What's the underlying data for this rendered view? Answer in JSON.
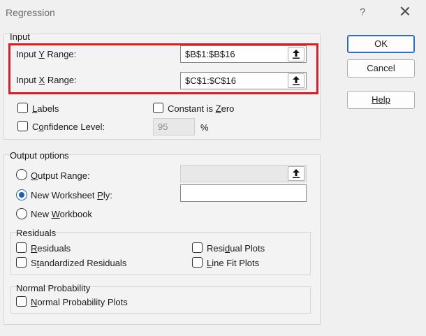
{
  "window": {
    "title": "Regression",
    "help_glyph": "?"
  },
  "buttons": {
    "ok": "OK",
    "cancel": "Cancel",
    "help": "Help"
  },
  "input_group": {
    "label": "Input",
    "y_range": {
      "label_pre": "Input ",
      "label_key": "Y",
      "label_post": " Range:",
      "value": "$B$1:$B$16"
    },
    "x_range": {
      "label_pre": "Input ",
      "label_key": "X",
      "label_post": " Range:",
      "value": "$C$1:$C$16"
    },
    "labels": {
      "key": "L",
      "rest": "abels",
      "checked": false
    },
    "constant_zero": {
      "pre": "Constant is ",
      "key": "Z",
      "rest": "ero",
      "checked": false
    },
    "confidence": {
      "pre": "C",
      "key": "o",
      "rest": "nfidence Level:",
      "value": "95",
      "unit": "%",
      "checked": false
    }
  },
  "output_group": {
    "label": "Output options",
    "output_range": {
      "key": "O",
      "rest": "utput Range:",
      "selected": false,
      "value": ""
    },
    "new_ply": {
      "pre": "New Worksheet ",
      "key": "P",
      "rest": "ly:",
      "selected": true,
      "value": ""
    },
    "new_workbook": {
      "pre": "New ",
      "key": "W",
      "rest": "orkbook",
      "selected": false
    }
  },
  "residuals_group": {
    "label": "Residuals",
    "residuals": {
      "key": "R",
      "rest": "esiduals",
      "checked": false
    },
    "standardized": {
      "key": "T",
      "pre": "S",
      "rest": "andardized Residuals",
      "checked": false
    },
    "residual_plots": {
      "pre": "Resi",
      "key": "d",
      "rest": "ual Plots",
      "checked": false
    },
    "line_fit": {
      "key": "L",
      "pre": "",
      "rest": "ine Fit Plots",
      "checked": false
    }
  },
  "normal_group": {
    "label": "Normal Probability",
    "plots": {
      "key": "N",
      "rest": "ormal Probability Plots",
      "checked": false
    }
  },
  "colors": {
    "highlight": "#e01b24",
    "accent": "#1b5fb4"
  }
}
